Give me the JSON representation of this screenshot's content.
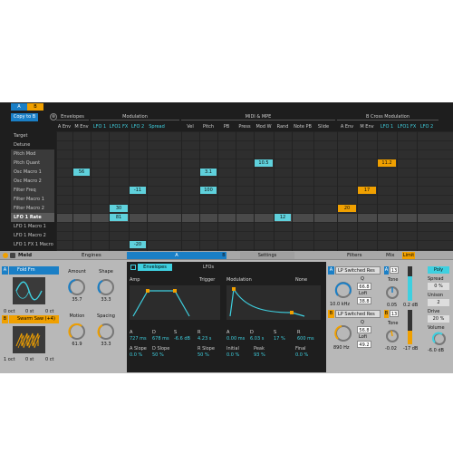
{
  "matrix": {
    "tab_a": "A",
    "tab_b": "B",
    "copy_button": "Copy to B",
    "close_glyph": "⊗",
    "row_labels": [
      "Target",
      "Detune",
      "Pitch Mod",
      "Pitch Quant",
      "Osc Macro 1",
      "Osc Macro 2",
      "Filter Freq",
      "Filter Macro 1",
      "Filter Macro 2",
      "LFO 1 Rate",
      "LFO 1 Macro 1",
      "LFO 1 Macro 2",
      "LFO 1 FX 1 Macro",
      "LFO 1 FX 2 Macro"
    ],
    "selected_row": "LFO 1 Rate",
    "groups": [
      "Envelopes",
      "Modulation",
      "MIDI & MPE",
      "B Cross Modulation"
    ],
    "columns": [
      "A Env",
      "M Env",
      "LFO 1",
      "LFO1 FX",
      "LFO 2",
      "Spread",
      "Vel",
      "Pitch",
      "PB",
      "Press",
      "Mod W",
      "Rand",
      "Note PB",
      "Slide",
      "A Env",
      "M Env",
      "LFO 1",
      "LFO1 FX",
      "LFO 2"
    ],
    "cells": [
      {
        "row": 4,
        "col": 1,
        "value": "56",
        "color": "#5fd1dc"
      },
      {
        "row": 3,
        "col": 10,
        "value": "10.5",
        "color": "#5fd1dc"
      },
      {
        "row": 4,
        "col": 7,
        "value": "3.1",
        "color": "#5fd1dc"
      },
      {
        "row": 3,
        "col": 16,
        "value": "11.2",
        "color": "#f0a000"
      },
      {
        "row": 6,
        "col": 4,
        "value": "-11",
        "color": "#5fd1dc"
      },
      {
        "row": 6,
        "col": 7,
        "value": "100",
        "color": "#5fd1dc"
      },
      {
        "row": 6,
        "col": 15,
        "value": "17",
        "color": "#f0a000"
      },
      {
        "row": 8,
        "col": 3,
        "value": "30",
        "color": "#5fd1dc"
      },
      {
        "row": 8,
        "col": 14,
        "value": "20",
        "color": "#f0a000"
      },
      {
        "row": 9,
        "col": 3,
        "value": "81",
        "color": "#5fd1dc"
      },
      {
        "row": 9,
        "col": 11,
        "value": "12",
        "color": "#5fd1dc"
      },
      {
        "row": 12,
        "col": 4,
        "value": "-20",
        "color": "#5fd1dc"
      }
    ]
  },
  "device": {
    "name": "Meld",
    "engines_label": "Engines",
    "tab_a": "A",
    "tab_b": "B",
    "settings_label": "Settings",
    "filters_label": "Filters",
    "mix_label": "Mix",
    "limit_label": "Limit",
    "osc_a": {
      "letter": "A",
      "type": "Fold Fm",
      "oct": "0 oct",
      "st": "0 st",
      "ct": "0 ct",
      "amount_label": "Amount",
      "amount_value": "35.7",
      "shape_label": "Shape",
      "shape_value": "33.3"
    },
    "osc_b": {
      "letter": "B",
      "type": "Swarm Saw (+4)",
      "oct": "1 oct",
      "st": "0 st",
      "ct": "0 ct",
      "motion_label": "Motion",
      "motion_value": "61.9",
      "spacing_label": "Spacing",
      "spacing_value": "33.3"
    },
    "env_tabs": [
      "Envelopes",
      "LFOs"
    ],
    "amp": {
      "label": "Amp",
      "trigger": "Trigger",
      "values": [
        {
          "l": "A",
          "v": "727 ms"
        },
        {
          "l": "D",
          "v": "678 ms"
        },
        {
          "l": "S",
          "v": "-6.6 dB"
        },
        {
          "l": "R",
          "v": "4.23 s"
        }
      ],
      "aslope_label": "A Slope",
      "aslope_value": "0.0 %",
      "dslope_label": "D Slope",
      "dslope_value": "50 %",
      "rslope_label": "R Slope",
      "rslope_value": "50 %"
    },
    "mod": {
      "label": "Modulation",
      "none": "None",
      "values": [
        {
          "l": "A",
          "v": "0.00 ms"
        },
        {
          "l": "D",
          "v": "6.03 s"
        },
        {
          "l": "S",
          "v": "17 %"
        },
        {
          "l": "R",
          "v": "600 ms"
        }
      ],
      "initial_label": "Initial",
      "initial_value": "0.0 %",
      "peak_label": "Peak",
      "peak_value": "93 %",
      "final_label": "Final",
      "final_value": "0.0 %"
    },
    "filter_a": {
      "type": "LP Switched Res",
      "q_label": "Q",
      "q_value": "66.8",
      "lofi_label": "Lofi",
      "lofi_value": "38.8",
      "freq": "10.0 kHz"
    },
    "filter_b": {
      "type": "LP Switched Res",
      "q_label": "Q",
      "q_value": "56.8",
      "lofi_label": "Lofi",
      "lofi_value": "49.2",
      "freq": "890 Hz"
    },
    "mix_a": {
      "num": "13",
      "tone_label": "Tone",
      "tone_value": "0.05",
      "vol": "0.2 dB"
    },
    "mix_b": {
      "num": "13",
      "tone_label": "Tone",
      "tone_value": "-0.02",
      "vol": "-17 dB"
    },
    "voice": {
      "mode": "Poly",
      "spread_label": "Spread",
      "spread_value": "0 %",
      "unison_label": "Unison",
      "unison_value": "2",
      "drive_label": "Drive",
      "drive_value": "20 %",
      "volume_label": "Volume",
      "volume_value": "-6.0 dB"
    }
  }
}
